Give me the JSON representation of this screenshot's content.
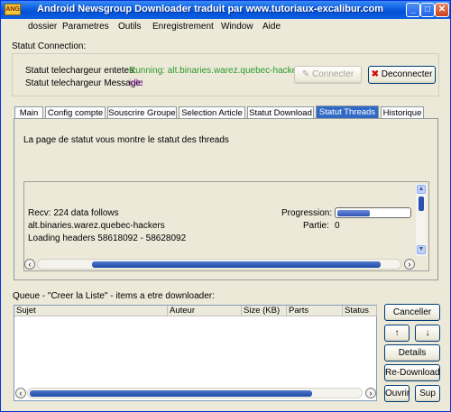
{
  "window": {
    "title": "Android Newsgroup Downloader traduit par www.tutoriaux-excalibur.com",
    "icon_text": "ANG"
  },
  "menu": [
    "dossier",
    "Parametres",
    "Outils",
    "Enregistrement",
    "Window",
    "Aide"
  ],
  "connection": {
    "section_title": "Statut Connection:",
    "header_label": "Statut telechargeur entetes:",
    "header_value": "Running: alt.binaries.warez.quebec-hackers",
    "message_label": "Statut telechargeur Message:",
    "message_value": "idle",
    "connect_label": "Connecter",
    "disconnect_label": "Deconnecter"
  },
  "tabs": [
    "Main",
    "Config compte",
    "Souscrire Groupe",
    "Selection Article",
    "Statut Download",
    "Statut Threads",
    "Historique"
  ],
  "active_tab": "Statut Threads",
  "threads": {
    "description": "La page de statut vous montre le statut des threads",
    "recv": "Recv: 224 data follows",
    "group": "alt.binaries.warez.quebec-hackers",
    "loading": "Loading headers 58618092 - 58628092",
    "progression_label": "Progression:",
    "progression_value": 0.45,
    "partie_label": "Partie:",
    "partie_value": "0",
    "hscroll_position": 0.95
  },
  "queue": {
    "title": "Queue - \"Creer la Liste\" - items a etre downloader:",
    "columns": [
      "Sujet",
      "Auteur",
      "Size (KB)",
      "Parts",
      "Status"
    ],
    "hscroll_position": 0.85
  },
  "side_buttons": {
    "cancel": "Canceller",
    "up": "↑",
    "down": "↓",
    "details": "Details",
    "redownload": "Re-Download",
    "open": "Ouvrir",
    "delete": "Sup"
  },
  "colors": {
    "titlebar": "#0a5fe0",
    "running": "#2a9a2a",
    "idle": "#8a1fa0",
    "active_tab": "#316ac5",
    "progress": "#2d52b2"
  }
}
